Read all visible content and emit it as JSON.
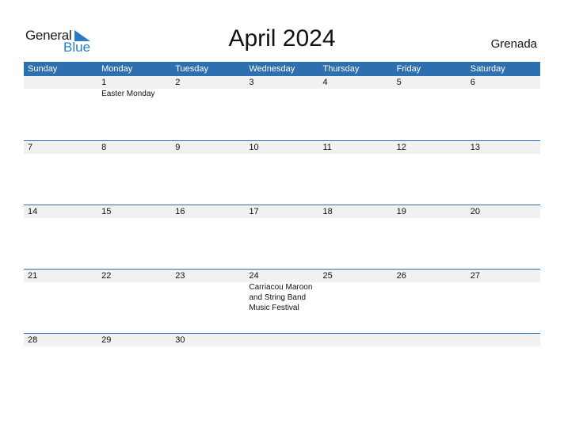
{
  "logo": {
    "word1": "General",
    "word2": "Blue"
  },
  "title": "April 2024",
  "country": "Grenada",
  "weekdays": [
    "Sunday",
    "Monday",
    "Tuesday",
    "Wednesday",
    "Thursday",
    "Friday",
    "Saturday"
  ],
  "weeks": [
    {
      "days": [
        "",
        "1",
        "2",
        "3",
        "4",
        "5",
        "6"
      ],
      "events": [
        "",
        "Easter Monday",
        "",
        "",
        "",
        "",
        ""
      ]
    },
    {
      "days": [
        "7",
        "8",
        "9",
        "10",
        "11",
        "12",
        "13"
      ],
      "events": [
        "",
        "",
        "",
        "",
        "",
        "",
        ""
      ]
    },
    {
      "days": [
        "14",
        "15",
        "16",
        "17",
        "18",
        "19",
        "20"
      ],
      "events": [
        "",
        "",
        "",
        "",
        "",
        "",
        ""
      ]
    },
    {
      "days": [
        "21",
        "22",
        "23",
        "24",
        "25",
        "26",
        "27"
      ],
      "events": [
        "",
        "",
        "",
        "Carriacou Maroon and String Band Music Festival",
        "",
        "",
        ""
      ]
    },
    {
      "days": [
        "28",
        "29",
        "30",
        "",
        "",
        "",
        ""
      ],
      "events": [
        "",
        "",
        "",
        "",
        "",
        "",
        ""
      ]
    }
  ],
  "colors": {
    "header": "#2e6fb0",
    "logo_blue": "#2a7dc2",
    "date_row": "#f1f1f1"
  }
}
